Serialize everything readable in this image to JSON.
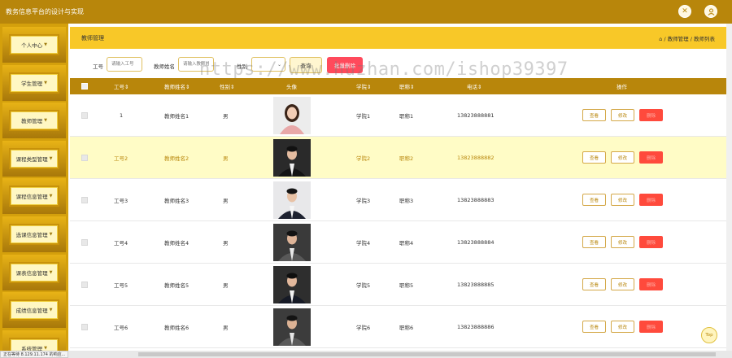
{
  "app": {
    "title": "教务信息平台的设计与实现"
  },
  "sidebar": {
    "items": [
      {
        "label": "个人中心"
      },
      {
        "label": "学生管理"
      },
      {
        "label": "教师管理"
      },
      {
        "label": "课程类型管理"
      },
      {
        "label": "课程信息管理"
      },
      {
        "label": "选课信息管理"
      },
      {
        "label": "课表信息管理"
      },
      {
        "label": "成绩信息管理"
      },
      {
        "label": "系统管理"
      }
    ]
  },
  "breadcrumb": {
    "page": "教师管理",
    "home_icon": "home-icon",
    "path": "/ 教师管理 / 教师列表"
  },
  "search": {
    "gonghao_label": "工号",
    "gonghao_placeholder": "请输入工号",
    "name_label": "教师姓名",
    "name_placeholder": "请输入教师姓名",
    "gender_label": "性别",
    "query_label": "查询",
    "batch_delete_label": "批量删除"
  },
  "watermark": "https://www.huzhan.com/ishop39397",
  "table": {
    "headers": {
      "gonghao": "工号⇕",
      "name": "教师姓名⇕",
      "gender": "性别⇕",
      "avatar": "头像",
      "college": "学院⇕",
      "title": "职称⇕",
      "phone": "电话⇕",
      "ops": "操作"
    },
    "rows": [
      {
        "gonghao": "1",
        "name": "教师姓名1",
        "gender": "男",
        "college": "学院1",
        "title": "职称1",
        "phone": "13823888881"
      },
      {
        "gonghao": "工号2",
        "name": "教师姓名2",
        "gender": "男",
        "college": "学院2",
        "title": "职称2",
        "phone": "13823888882"
      },
      {
        "gonghao": "工号3",
        "name": "教师姓名3",
        "gender": "男",
        "college": "学院3",
        "title": "职称3",
        "phone": "13823888883"
      },
      {
        "gonghao": "工号4",
        "name": "教师姓名4",
        "gender": "男",
        "college": "学院4",
        "title": "职称4",
        "phone": "13823888884"
      },
      {
        "gonghao": "工号5",
        "name": "教师姓名5",
        "gender": "男",
        "college": "学院5",
        "title": "职称5",
        "phone": "13823888885"
      },
      {
        "gonghao": "工号6",
        "name": "教师姓名6",
        "gender": "男",
        "college": "学院6",
        "title": "职称6",
        "phone": "13823888886"
      }
    ],
    "ops": {
      "view": "查看",
      "edit": "修改",
      "delete": "删除"
    }
  },
  "status_bar": "正在等待 8.129.11.174 的响应...",
  "top_button": "Top",
  "colors": {
    "brand": "#b8860b",
    "header_yellow": "#f8c828",
    "delete_red": "#ff4a3c",
    "highlight_row": "#fffcc6"
  }
}
